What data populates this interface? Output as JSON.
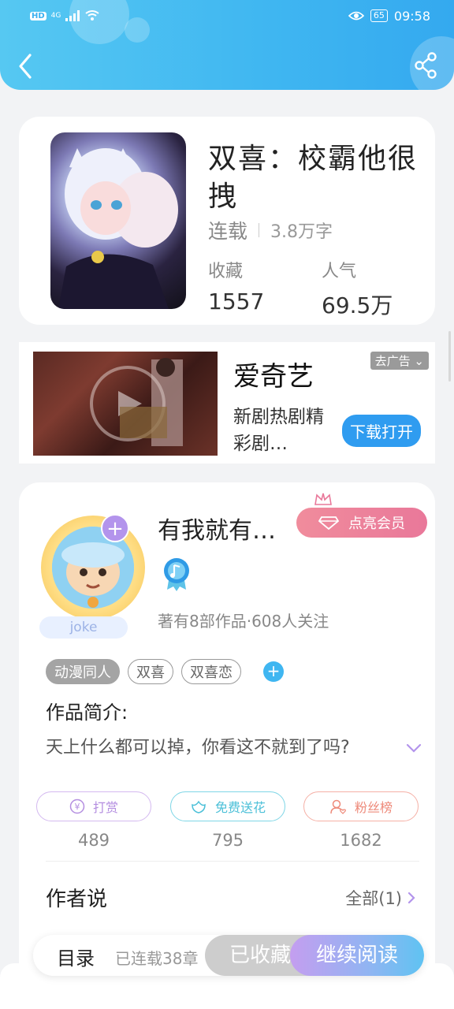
{
  "status_bar": {
    "network": "4G",
    "battery": "65",
    "time": "09:58"
  },
  "book": {
    "title": "双喜：校霸他很拽",
    "status": "连载",
    "word_count": "3.8万字",
    "favorites_label": "收藏",
    "favorites_value": "1557",
    "popularity_label": "人气",
    "popularity_value": "69.5万"
  },
  "ad": {
    "title": "爱奇艺",
    "description": "新剧热剧精彩剧…",
    "close_label": "去广告",
    "cta_label": "下载打开"
  },
  "author": {
    "name": "有我就有…",
    "avatar_name": "joke",
    "vip_label": "点亮会员",
    "stats": "著有8部作品·608人关注",
    "tags": [
      "动漫同人",
      "双喜",
      "双喜恋"
    ],
    "intro_label": "作品简介:",
    "intro_text": "天上什么都可以掉，你看这不就到了吗?",
    "actions": [
      {
        "label": "打赏",
        "count": "489",
        "color": "#c9a6ec"
      },
      {
        "label": "免费送花",
        "count": "795",
        "color": "#5fcfe0"
      },
      {
        "label": "粉丝榜",
        "count": "1682",
        "color": "#f39a8a"
      }
    ],
    "author_say_label": "作者说",
    "all_label": "全部(1)"
  },
  "bottom": {
    "toc_label": "目录",
    "progress": "已连载38章",
    "collected_label": "已收藏",
    "continue_label": "继续阅读"
  },
  "colors": {
    "header": "#3fb6f1",
    "accent": "#2f9cf0",
    "vip": "#e9789a"
  }
}
